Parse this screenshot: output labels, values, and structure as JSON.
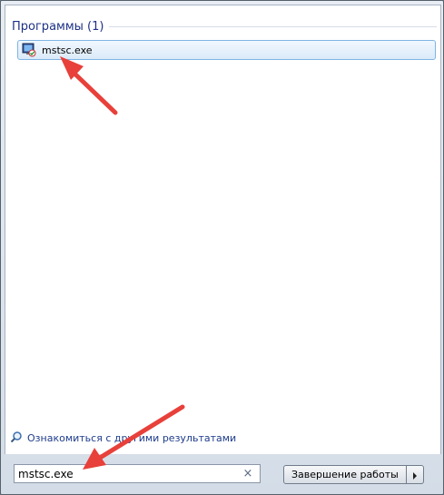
{
  "start_menu": {
    "section_title": "Программы (1)",
    "results": [
      {
        "label": "mstsc.exe",
        "icon": "remote-desktop-icon"
      }
    ],
    "more_results_label": "Ознакомиться с другими результатами",
    "search": {
      "value": "mstsc.exe",
      "clear_icon": "×"
    },
    "shutdown_label": "Завершение работы"
  },
  "colors": {
    "section_title": "#1e3287",
    "highlight_border": "#7fb4e4",
    "annotation_arrow": "#e8403a"
  }
}
